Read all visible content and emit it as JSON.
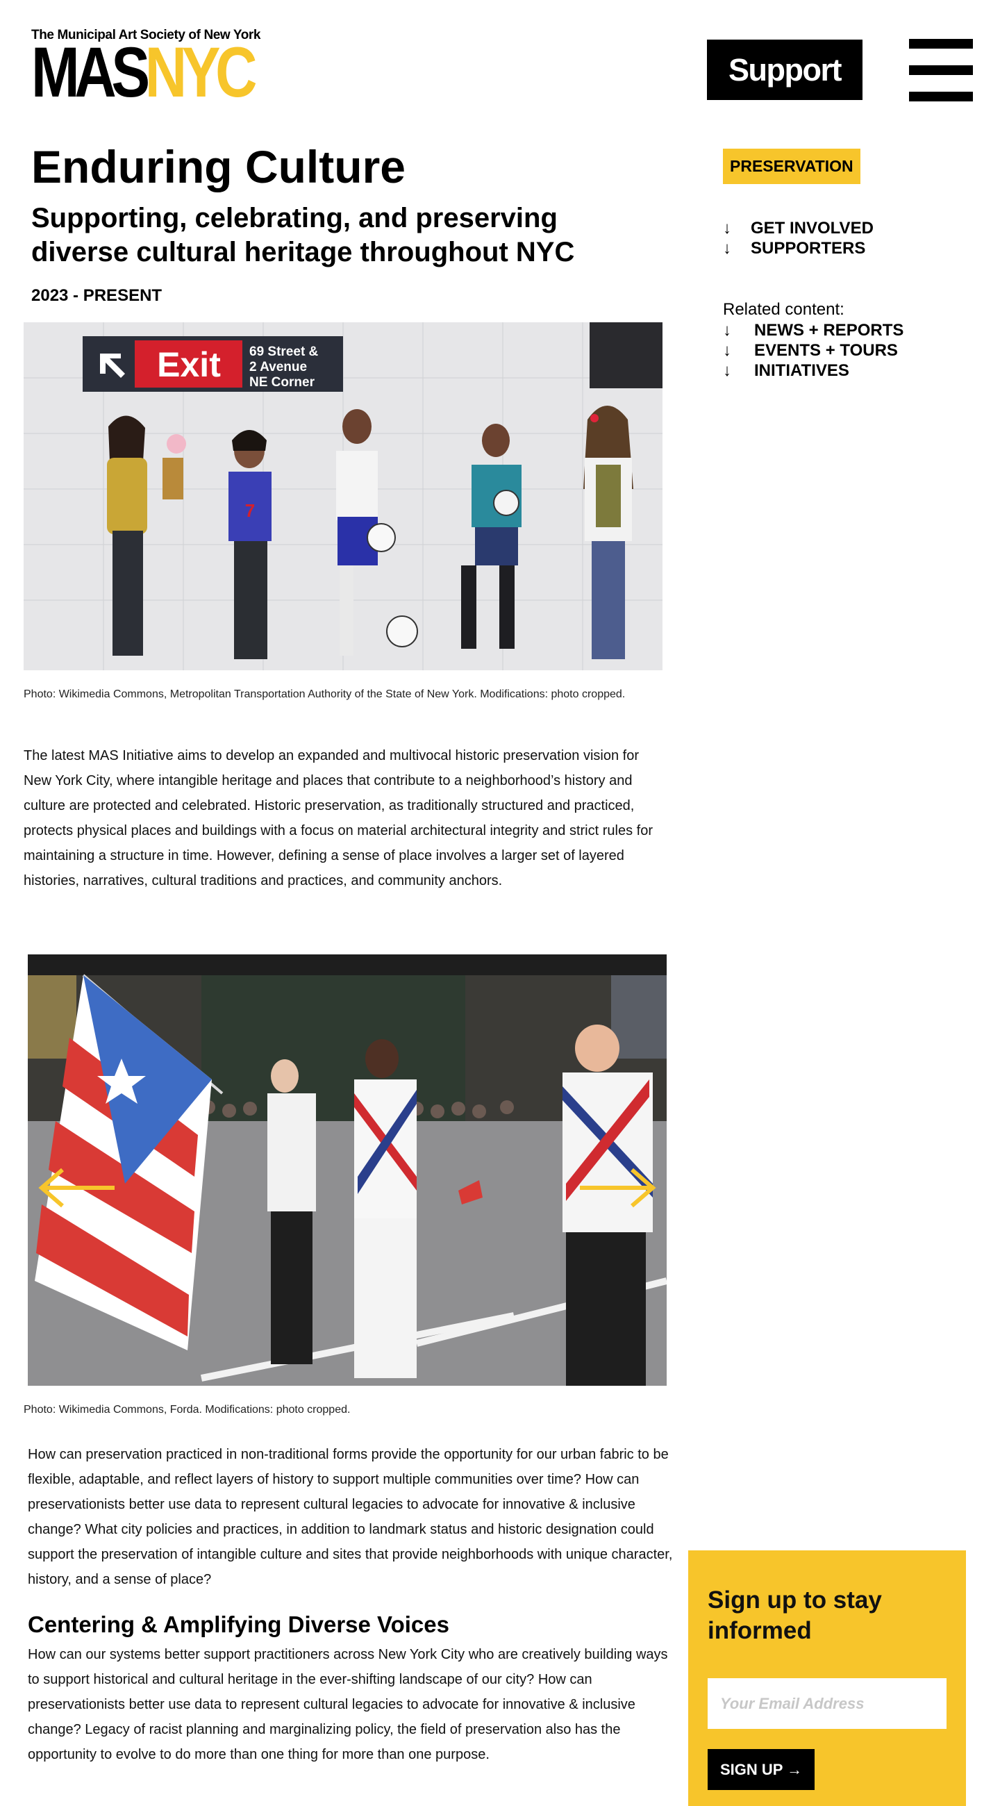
{
  "header": {
    "logo_top": "The Municipal Art Society of New York",
    "logo_mas": "MAS",
    "logo_nyc": "NYC",
    "support_label": "Support",
    "menu_icon": "hamburger-menu-icon"
  },
  "page": {
    "title": "Enduring Culture",
    "subtitle": "Supporting, celebrating, and preserving diverse cultural heritage throughout NYC",
    "date_range": "2023 - PRESENT"
  },
  "sidebar": {
    "tag": "PRESERVATION",
    "links": [
      {
        "arrow": "↓",
        "label": "GET INVOLVED"
      },
      {
        "arrow": "↓",
        "label": "SUPPORTERS"
      }
    ],
    "related_label": "Related content:",
    "related_links": [
      {
        "arrow": "↓",
        "label": "NEWS + REPORTS"
      },
      {
        "arrow": "↓",
        "label": "EVENTS + TOURS"
      },
      {
        "arrow": "↓",
        "label": "INITIATIVES"
      }
    ]
  },
  "figure1": {
    "sign_exit": "Exit",
    "sign_line1": "69 Street &",
    "sign_line2": "2 Avenue",
    "sign_line3": "NE Corner",
    "caption": "Photo: Wikimedia Commons, Metropolitan Transportation Authority of the State of New York. Modifications: photo cropped."
  },
  "figure2": {
    "caption": "Photo: Wikimedia Commons, Forda. Modifications: photo cropped.",
    "prev_icon": "arrow-left-icon",
    "next_icon": "arrow-right-icon"
  },
  "content": {
    "para1": "The latest MAS Initiative aims to develop an expanded and multivocal historic preservation vision for New York City, where intangible heritage and places that contribute to a neighborhood’s history and culture are protected and celebrated. Historic preservation, as traditionally structured and practiced, protects physical places and buildings with a focus on material architectural integrity and strict rules for maintaining a structure in time. However, defining a sense of place involves a larger set of layered histories, narratives, cultural traditions and practices, and community anchors.",
    "para2": "How can preservation practiced in non-traditional forms provide the opportunity for our urban fabric to be flexible, adaptable, and reflect layers of history to support multiple communities over time? How can preservationists better use data to represent cultural legacies to advocate for innovative & inclusive change? What city policies and practices, in addition to landmark status and historic designation could support the preservation of intangible culture and sites that provide neighborhoods with unique character, history, and a sense of place?",
    "heading": "Centering & Amplifying Diverse Voices",
    "para3": "How can our systems better support practitioners across New York City who are creatively building ways to support historical and cultural heritage in the ever-shifting landscape of our city? How can preservationists better use data to represent cultural legacies to advocate for innovative & inclusive change? Legacy of racist planning and marginalizing policy, the field of preservation also has the opportunity to evolve to do more than one thing for more than one purpose."
  },
  "newsletter": {
    "title": "Sign up to stay informed",
    "email_placeholder": "Your Email Address",
    "button_label": "SIGN UP →"
  },
  "colors": {
    "accent_yellow": "#f7c52b",
    "black": "#000000"
  }
}
